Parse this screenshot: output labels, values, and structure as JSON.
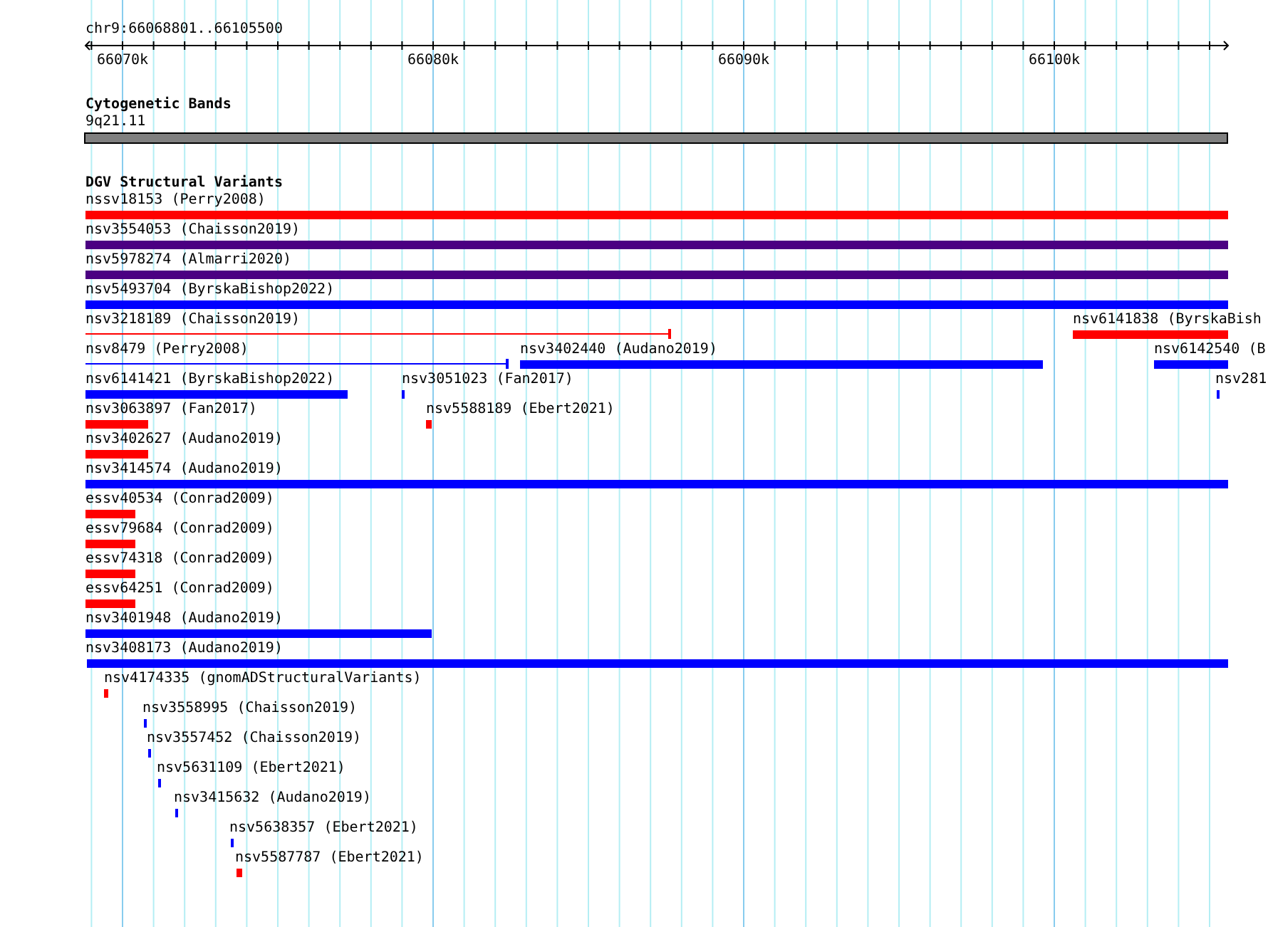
{
  "ruler": {
    "position": "chr9:66068801..66105500",
    "ticks": [
      "66070k",
      "66080k",
      "66090k",
      "66100k"
    ]
  },
  "cytogenetic_track": {
    "title": "Cytogenetic Bands",
    "band": "9q21.11"
  },
  "dgv_track": {
    "title": "DGV Structural Variants",
    "rows": [
      {
        "features": [
          {
            "label": "nssv18153 (Perry2008)",
            "color": "#ff0000",
            "kind": "bar"
          }
        ]
      },
      {
        "features": [
          {
            "label": "nsv3554053 (Chaisson2019)",
            "color": "#4b0082",
            "kind": "bar"
          }
        ]
      },
      {
        "features": [
          {
            "label": "nsv5978274 (Almarri2020)",
            "color": "#4b0082",
            "kind": "bar"
          }
        ]
      },
      {
        "features": [
          {
            "label": "nsv5493704 (ByrskaBishop2022)",
            "color": "#0000ff",
            "kind": "bar"
          }
        ]
      },
      {
        "features": [
          {
            "label": "nsv3218189 (Chaisson2019)",
            "color": "#ff0000",
            "kind": "span"
          },
          {
            "label": "nsv6141838 (ByrskaBish",
            "color": "#ff0000",
            "kind": "bar"
          }
        ]
      },
      {
        "features": [
          {
            "label": "nsv8479 (Perry2008)",
            "color": "#0000ff",
            "kind": "span"
          },
          {
            "label": "nsv3402440 (Audano2019)",
            "color": "#0000ff",
            "kind": "bar"
          },
          {
            "label": "nsv6142540 (B",
            "color": "#0000ff",
            "kind": "bar"
          }
        ]
      },
      {
        "features": [
          {
            "label": "nsv6141421 (ByrskaBishop2022)",
            "color": "#0000ff",
            "kind": "bar"
          },
          {
            "label": "nsv3051023 (Fan2017)",
            "color": "#0000ff",
            "kind": "bar"
          },
          {
            "label": "nsv281",
            "color": "#0000ff",
            "kind": "bar"
          }
        ]
      },
      {
        "features": [
          {
            "label": "nsv3063897 (Fan2017)",
            "color": "#ff0000",
            "kind": "bar"
          },
          {
            "label": "nsv5588189 (Ebert2021)",
            "color": "#ff0000",
            "kind": "bar"
          }
        ]
      },
      {
        "features": [
          {
            "label": "nsv3402627 (Audano2019)",
            "color": "#ff0000",
            "kind": "bar"
          }
        ]
      },
      {
        "features": [
          {
            "label": "nsv3414574 (Audano2019)",
            "color": "#0000ff",
            "kind": "bar"
          }
        ]
      },
      {
        "features": [
          {
            "label": "essv40534 (Conrad2009)",
            "color": "#ff0000",
            "kind": "bar"
          }
        ]
      },
      {
        "features": [
          {
            "label": "essv79684 (Conrad2009)",
            "color": "#ff0000",
            "kind": "bar"
          }
        ]
      },
      {
        "features": [
          {
            "label": "essv74318 (Conrad2009)",
            "color": "#ff0000",
            "kind": "bar"
          }
        ]
      },
      {
        "features": [
          {
            "label": "essv64251 (Conrad2009)",
            "color": "#ff0000",
            "kind": "bar"
          }
        ]
      },
      {
        "features": [
          {
            "label": "nsv3401948 (Audano2019)",
            "color": "#0000ff",
            "kind": "bar"
          }
        ]
      },
      {
        "features": [
          {
            "label": "nsv3408173 (Audano2019)",
            "color": "#0000ff",
            "kind": "bar"
          }
        ]
      },
      {
        "features": [
          {
            "label": "nsv4174335 (gnomADStructuralVariants)",
            "color": "#ff0000",
            "kind": "bar"
          }
        ]
      },
      {
        "features": [
          {
            "label": "nsv3558995 (Chaisson2019)",
            "color": "#0000ff",
            "kind": "bar"
          }
        ]
      },
      {
        "features": [
          {
            "label": "nsv3557452 (Chaisson2019)",
            "color": "#0000ff",
            "kind": "bar"
          }
        ]
      },
      {
        "features": [
          {
            "label": "nsv5631109 (Ebert2021)",
            "color": "#0000ff",
            "kind": "bar"
          }
        ]
      },
      {
        "features": [
          {
            "label": "nsv3415632 (Audano2019)",
            "color": "#0000ff",
            "kind": "bar"
          }
        ]
      },
      {
        "features": [
          {
            "label": "nsv5638357 (Ebert2021)",
            "color": "#0000ff",
            "kind": "bar"
          }
        ]
      },
      {
        "features": [
          {
            "label": "nsv5587787 (Ebert2021)",
            "color": "#ff0000",
            "kind": "bar"
          }
        ]
      }
    ]
  }
}
